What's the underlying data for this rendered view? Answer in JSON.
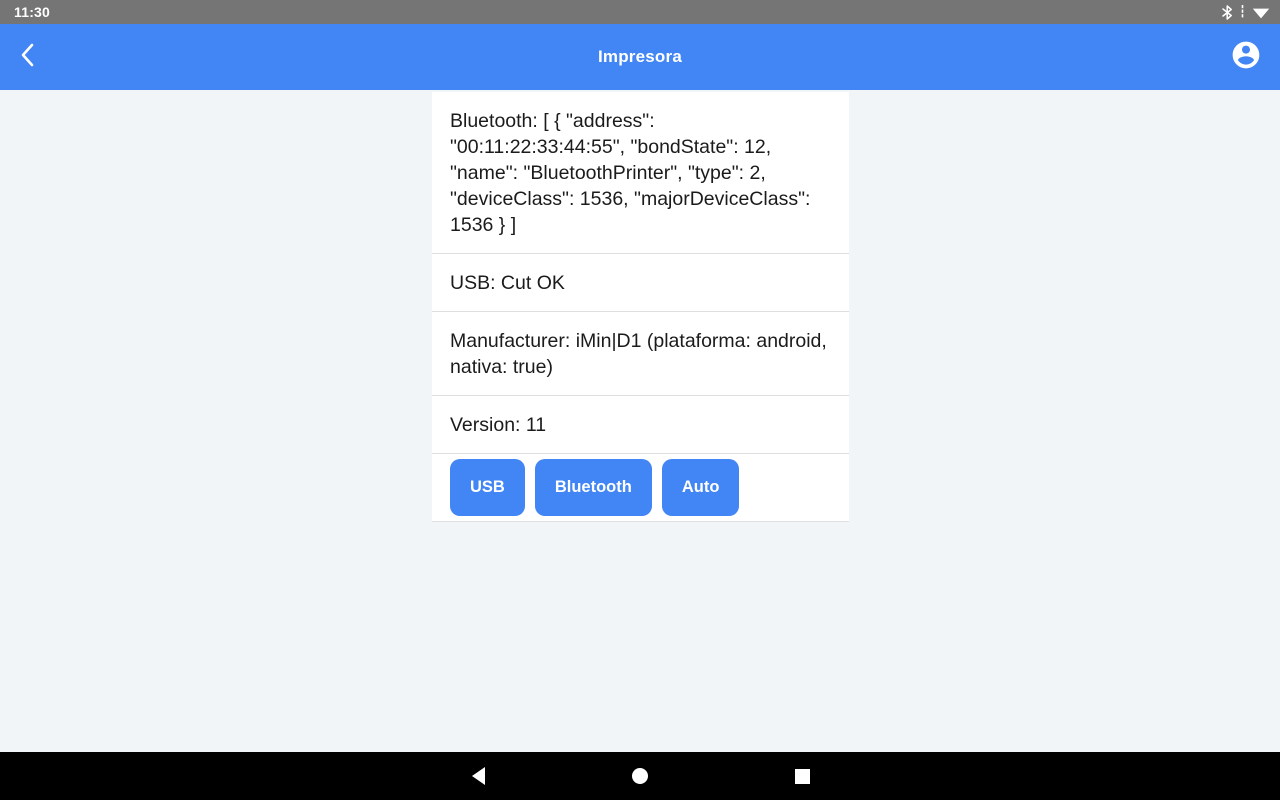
{
  "status_bar": {
    "clock": "11:30",
    "icons": [
      {
        "name": "bluetooth-icon"
      },
      {
        "name": "mobile-signal-icon"
      },
      {
        "name": "wifi-icon"
      }
    ],
    "background": "#757575"
  },
  "app_bar": {
    "title": "Impresora",
    "back_icon": "chevron-left-icon",
    "account_icon": "account-circle-icon",
    "background": "#4285f4",
    "text_color": "#ffffff"
  },
  "card": {
    "rows": [
      {
        "id": "bluetooth-status",
        "text": "Bluetooth: [ { \"address\": \"00:11:22:33:44:55\", \"bondState\": 12, \"name\": \"BluetoothPrinter\", \"type\": 2, \"deviceClass\": 1536, \"majorDeviceClass\": 1536 } ]"
      },
      {
        "id": "usb-status",
        "text": "USB: Cut OK"
      },
      {
        "id": "manufacturer-info",
        "text": "Manufacturer: iMin|D1 (plataforma: android, nativa: true)"
      },
      {
        "id": "version-info",
        "text": "Version: 11"
      }
    ],
    "buttons": [
      {
        "id": "usb-button",
        "label": "USB"
      },
      {
        "id": "bluetooth-button",
        "label": "Bluetooth"
      },
      {
        "id": "auto-button",
        "label": "Auto"
      }
    ],
    "button_color": "#4285f4",
    "background": "#ffffff"
  },
  "nav_bar": {
    "background": "#000000",
    "buttons": [
      {
        "id": "nav-back",
        "name": "navigation-back-icon"
      },
      {
        "id": "nav-home",
        "name": "navigation-home-icon"
      },
      {
        "id": "nav-recents",
        "name": "navigation-recents-icon"
      }
    ]
  },
  "page": {
    "background": "#f1f5f8"
  }
}
